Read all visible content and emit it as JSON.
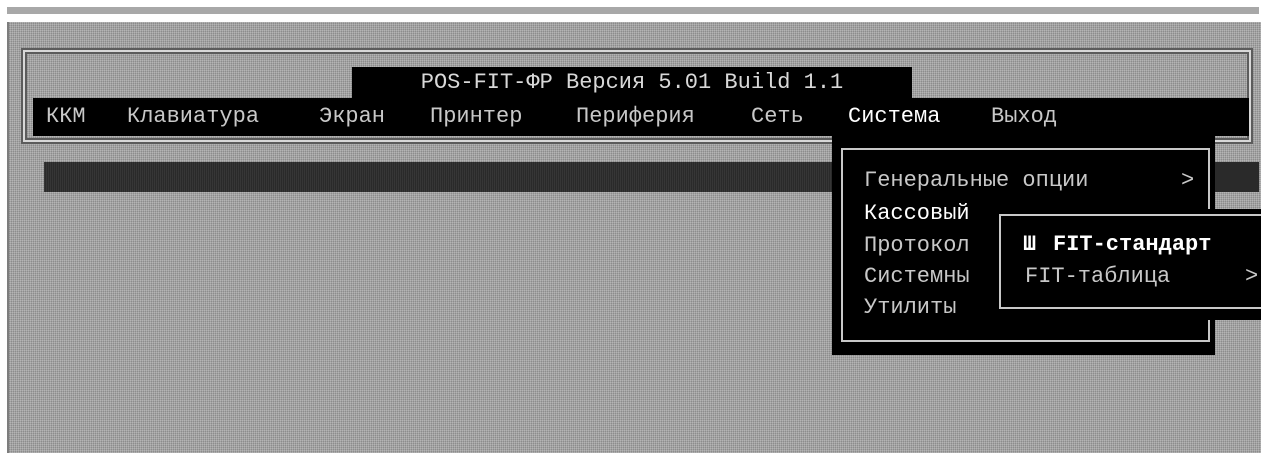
{
  "app": {
    "title": "POS-FIT-ФР Версия 5.01 Build 1.1"
  },
  "menubar": {
    "items": [
      {
        "label": "ККМ"
      },
      {
        "label": "Клавиатура"
      },
      {
        "label": "Экран"
      },
      {
        "label": "Принтер"
      },
      {
        "label": "Периферия"
      },
      {
        "label": "Сеть"
      },
      {
        "label": "Система",
        "active": true
      },
      {
        "label": "Выход"
      }
    ]
  },
  "system_menu": {
    "items": [
      {
        "label": "Генеральные опции",
        "submenu_arrow": ">"
      },
      {
        "label": "Кассовый",
        "highlighted": true
      },
      {
        "label": "Протокол"
      },
      {
        "label": "Системны"
      },
      {
        "label": "Утилиты"
      }
    ]
  },
  "submenu": {
    "items": [
      {
        "marker": "Ш",
        "label": "FIT-стандарт",
        "selected": true
      },
      {
        "label": "FIT-таблица",
        "submenu_arrow": ">"
      }
    ]
  },
  "colors": {
    "background_gray": "#a3a3a3",
    "menu_black": "#000000",
    "menu_text": "#c8c8c8",
    "active_text": "#ffffff"
  }
}
